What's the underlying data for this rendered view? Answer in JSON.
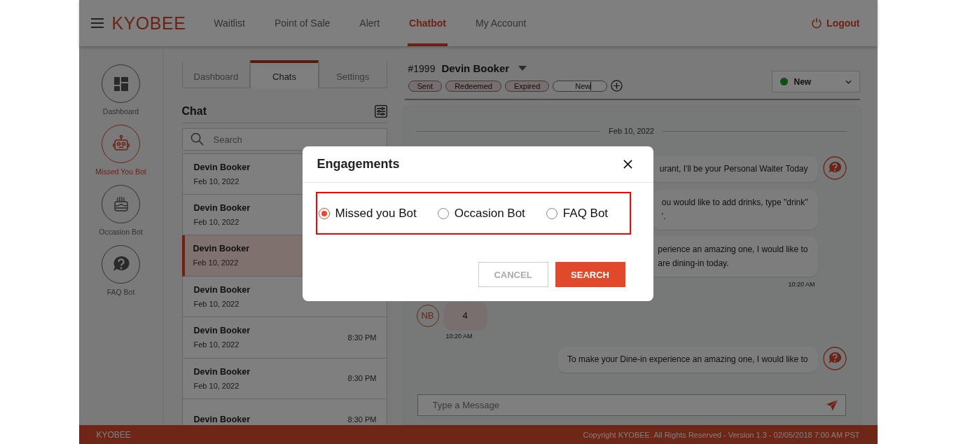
{
  "header": {
    "logo": "KYOBEE",
    "nav": [
      {
        "label": "Waitlist",
        "selected": false
      },
      {
        "label": "Point of Sale",
        "selected": false
      },
      {
        "label": "Alert",
        "selected": false
      },
      {
        "label": "Chatbot",
        "selected": true
      },
      {
        "label": "My Account",
        "selected": false
      }
    ],
    "logout": "Logout"
  },
  "sidebar": {
    "items": [
      {
        "label": "Dashboard",
        "selected": false
      },
      {
        "label": "Missed You Bot",
        "selected": true
      },
      {
        "label": "Occasion Bot",
        "selected": false
      },
      {
        "label": "FAQ Bot",
        "selected": false
      }
    ]
  },
  "chat_panel": {
    "tabs": [
      {
        "label": "Dashboard",
        "selected": false
      },
      {
        "label": "Chats",
        "selected": true
      },
      {
        "label": "Settings",
        "selected": false
      }
    ],
    "title": "Chat",
    "search": {
      "placeholder": "Search"
    },
    "conversations": [
      {
        "name": "Devin Booker",
        "date": "Feb 10, 2022",
        "selected": false
      },
      {
        "name": "Devin Booker",
        "date": "Feb 10, 2022",
        "selected": false
      },
      {
        "name": "Devin Booker",
        "date": "Feb 10, 2022",
        "selected": true
      },
      {
        "name": "Devin Booker",
        "date": "Feb 10, 2022",
        "selected": false
      },
      {
        "name": "Devin Booker",
        "date": "Feb 10, 2022",
        "time": "8:30 PM",
        "selected": false
      },
      {
        "name": "Devin Booker",
        "date": "Feb 10, 2022",
        "time": "8:30 PM",
        "selected": false
      },
      {
        "name": "Devin Booker",
        "time": "8:30 PM",
        "selected": false
      }
    ]
  },
  "conversation": {
    "number": "#1999",
    "name": "Devin Booker",
    "tags": [
      {
        "label": "Sent",
        "kind": "tag"
      },
      {
        "label": "Redeemed",
        "kind": "tag"
      },
      {
        "label": "Expired",
        "kind": "tag"
      },
      {
        "label": "New",
        "kind": "input"
      }
    ],
    "status": "New",
    "date_divider": "Feb 10, 2022",
    "messages": [
      {
        "kind": "bot",
        "lines": [
          "urant, I'll be your Personal Waiter Today"
        ],
        "show_icon": true
      },
      {
        "kind": "bot",
        "lines": [
          "ou would like to add drinks, type \"drink\"",
          "'."
        ],
        "show_icon": false
      },
      {
        "kind": "bot",
        "lines": [
          "perience an amazing one, I would like to",
          "are dining-in today."
        ],
        "time": "10:20 AM",
        "show_icon": false
      },
      {
        "kind": "user",
        "avatar": "NB",
        "lines": [
          "4"
        ],
        "time": "10:20 AM"
      },
      {
        "kind": "bot",
        "lines": [
          "To make your Dine-in experience an amazing one, I would like to"
        ],
        "show_icon": true
      }
    ],
    "composer": {
      "placeholder": "Type a Message"
    }
  },
  "footer": {
    "brand": "KYOBEE",
    "copyright": "Copyright KYOBEE. All Rights Reserved - Version 1.3 - 02/05/2018 7:00 AM PST"
  },
  "dialog": {
    "title": "Engagements",
    "options": [
      {
        "label": "Missed you Bot",
        "selected": true
      },
      {
        "label": "Occasion Bot",
        "selected": false
      },
      {
        "label": "FAQ Bot",
        "selected": false
      }
    ],
    "buttons": [
      {
        "label": "CANCEL",
        "kind": "secondary"
      },
      {
        "label": "SEARCH",
        "kind": "primary"
      }
    ]
  }
}
